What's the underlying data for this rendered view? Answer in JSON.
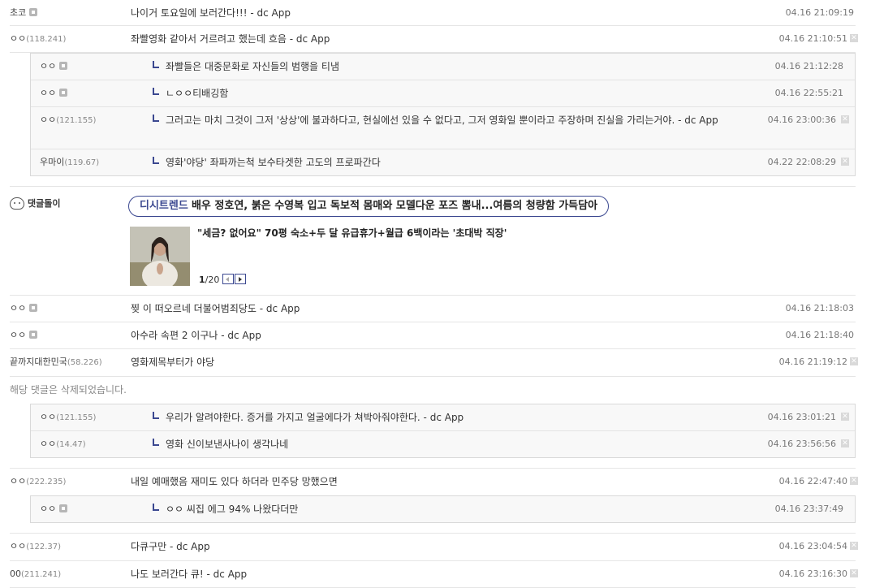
{
  "comments_top": [
    {
      "nick": "초코",
      "ip": "",
      "mark": true,
      "text": "나이거 토요일에 보러간다!!! - dc App",
      "date": "04.16 21:09:19",
      "x": false
    },
    {
      "nick": "ㅇㅇ",
      "ip": "(118.241)",
      "mark": false,
      "text": "좌빨영화 같아서 거르려고 했는데 흐음 - dc App",
      "date": "04.16 21:10:51",
      "x": true
    }
  ],
  "replies_1": [
    {
      "nick": "ㅇㅇ",
      "ip": "",
      "mark": true,
      "text": "좌빨들은 대중문화로 자신들의 범행을 티냄",
      "date": "04.16 21:12:28",
      "x": false
    },
    {
      "nick": "ㅇㅇ",
      "ip": "",
      "mark": true,
      "text": "ㄴㅇㅇ티배깅함",
      "date": "04.16 22:55:21",
      "x": false
    },
    {
      "nick": "ㅇㅇ",
      "ip": "(121.155)",
      "mark": false,
      "text": "그러고는 마치 그것이 그저 '상상'에 불과하다고, 현실에선 있을 수 없다고, 그저 영화일 뿐이라고 주장하며 진실을 가리는거야. - dc App",
      "date": "04.16 23:00:36",
      "x": true
    },
    {
      "nick": "우마이",
      "ip": "(119.67)",
      "mark": false,
      "text": "영화'야당' 좌파까는척 보수타겟한 고도의 프로파간다",
      "date": "04.22 22:08:29",
      "x": true
    }
  ],
  "ad": {
    "bot_label": "댓글돌이",
    "brand": "디시트렌드",
    "headline": "배우 정호연, 붉은 수영복 입고 독보적 몸매와 모델다운 포즈 뽐내...여름의 청량함 가득담아",
    "sub_headline": "\"세금? 없어요\" 70평 숙소+두 달 유급휴가+월급 6백이라는 '초대박 직장'",
    "page_current": "1",
    "page_total": "/20"
  },
  "comments_mid": [
    {
      "nick": "ㅇㅇ",
      "ip": "",
      "mark": true,
      "text": "찢 이 떠오르네 더불어범죄당도 - dc App",
      "date": "04.16 21:18:03",
      "x": false
    },
    {
      "nick": "ㅇㅇ",
      "ip": "",
      "mark": true,
      "text": "아수라 속편 2 이구나 - dc App",
      "date": "04.16 21:18:40",
      "x": false
    },
    {
      "nick": "끝까지대한민국",
      "ip": "(58.226)",
      "mark": false,
      "text": "영화제목부터가 야당",
      "date": "04.16 21:19:12",
      "x": true
    }
  ],
  "deleted_text": "해당 댓글은 삭제되었습니다.",
  "replies_2": [
    {
      "nick": "ㅇㅇ",
      "ip": "(121.155)",
      "mark": false,
      "text": "우리가 알려야한다. 증거를 가지고 얼굴에다가 쳐박아줘야한다. - dc App",
      "date": "04.16 23:01:21",
      "x": true
    },
    {
      "nick": "ㅇㅇ",
      "ip": "(14.47)",
      "mark": false,
      "text": "영화 신이보낸사나이 생각나네",
      "date": "04.16 23:56:56",
      "x": true
    }
  ],
  "comment_222": {
    "nick": "ㅇㅇ",
    "ip": "(222.235)",
    "mark": false,
    "text": "내일 예매했음 재미도 있다 하더라 민주당 망했으면",
    "date": "04.16 22:47:40",
    "x": true
  },
  "replies_3": [
    {
      "nick": "ㅇㅇ",
      "ip": "",
      "mark": true,
      "text": "ㅇㅇ 씨집 에그 94% 나왔다더만",
      "date": "04.16 23:37:49",
      "x": false
    }
  ],
  "comments_bottom": [
    {
      "nick": "ㅇㅇ",
      "ip": "(122.37)",
      "mark": false,
      "text": "다큐구만 - dc App",
      "date": "04.16 23:04:54",
      "x": true
    },
    {
      "nick": "00",
      "ip": "(211.241)",
      "mark": false,
      "text": "나도 보러간다 큐! - dc App",
      "date": "04.16 23:16:30",
      "x": true
    }
  ]
}
